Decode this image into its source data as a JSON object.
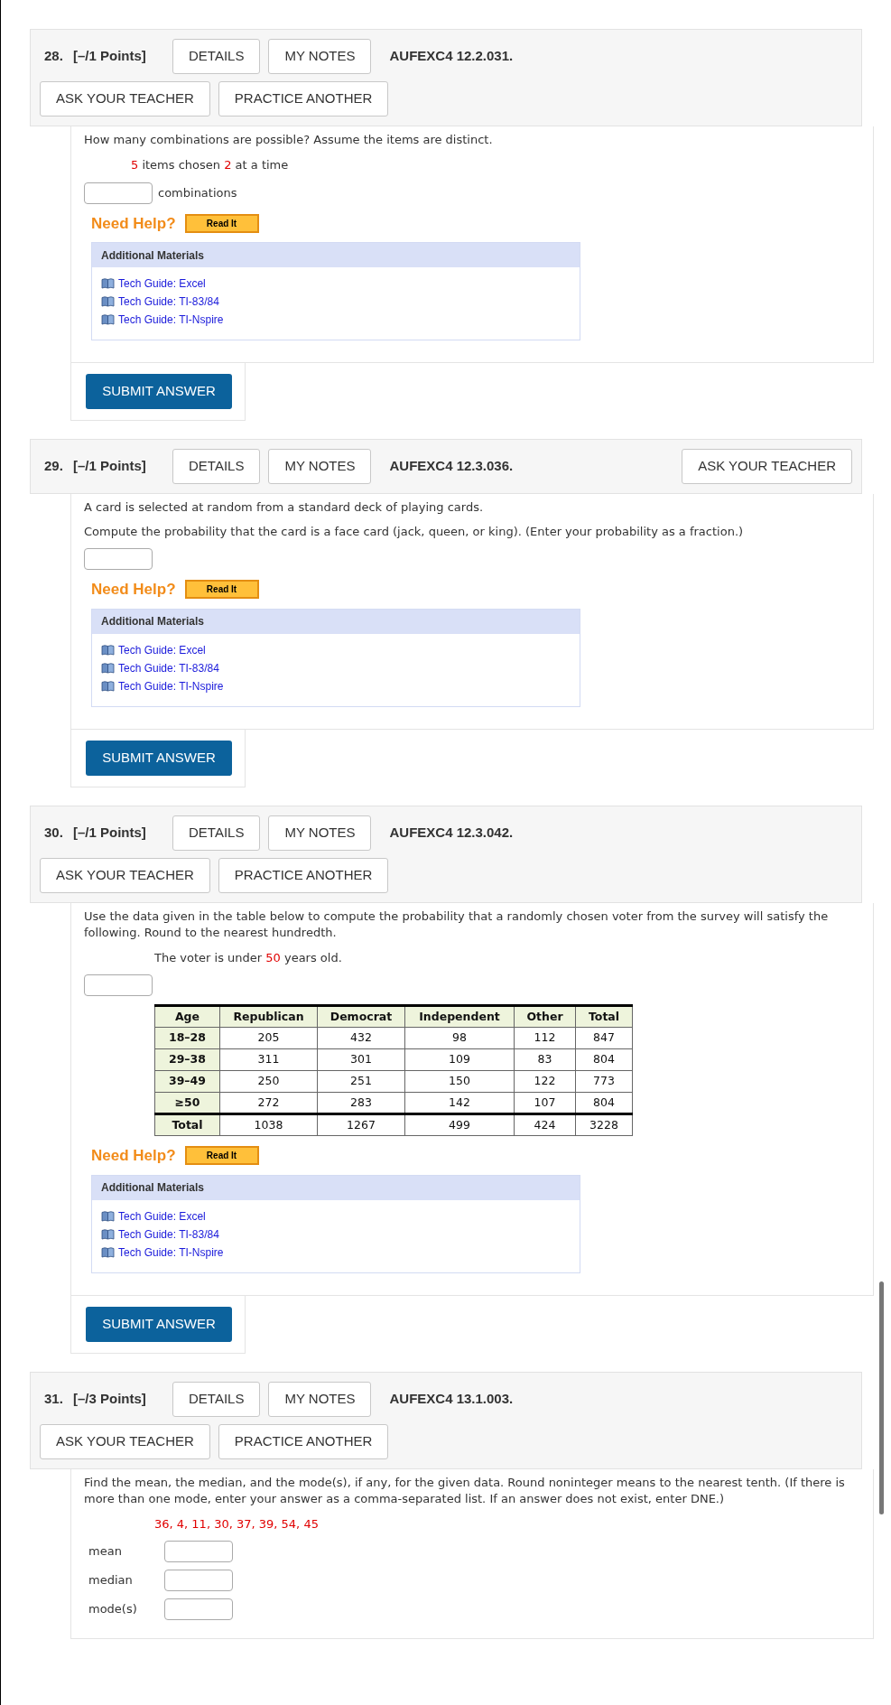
{
  "questions": [
    {
      "number": "28.",
      "points": "[–/1 Points]",
      "buttons": [
        "DETAILS",
        "MY NOTES"
      ],
      "code": "AUFEXC4 12.2.031.",
      "row2_buttons": [
        "ASK YOUR TEACHER",
        "PRACTICE ANOTHER"
      ],
      "blocks": [
        {
          "kind": "text",
          "text": "How many combinations are possible? Assume the items are distinct."
        },
        {
          "kind": "given",
          "parts": [
            {
              "text": "5",
              "highlight": true
            },
            {
              "text": " items chosen ",
              "highlight": false
            },
            {
              "text": "2",
              "highlight": true
            },
            {
              "text": " at a time",
              "highlight": false
            }
          ]
        },
        {
          "kind": "input",
          "suffix": "combinations"
        }
      ],
      "help": {
        "label": "Need Help?",
        "buttons": [
          "Read It"
        ],
        "materials_title": "Additional Materials",
        "links": [
          "Tech Guide: Excel",
          "Tech Guide: TI-83/84",
          "Tech Guide: TI-Nspire"
        ]
      },
      "submit": "SUBMIT ANSWER"
    },
    {
      "number": "29.",
      "points": "[–/1 Points]",
      "buttons": [
        "DETAILS",
        "MY NOTES"
      ],
      "code": "AUFEXC4 12.3.036.",
      "right_buttons": [
        "ASK YOUR TEACHER"
      ],
      "blocks": [
        {
          "kind": "text",
          "text": "A card is selected at random from a standard deck of playing cards."
        },
        {
          "kind": "text",
          "text": "Compute the probability that the card is a face card (jack, queen, or king). (Enter your probability as a fraction.)"
        },
        {
          "kind": "input"
        }
      ],
      "help": {
        "label": "Need Help?",
        "buttons": [
          "Read It"
        ],
        "materials_title": "Additional Materials",
        "links": [
          "Tech Guide: Excel",
          "Tech Guide: TI-83/84",
          "Tech Guide: TI-Nspire"
        ]
      },
      "submit": "SUBMIT ANSWER"
    },
    {
      "number": "30.",
      "points": "[–/1 Points]",
      "buttons": [
        "DETAILS",
        "MY NOTES"
      ],
      "code": "AUFEXC4 12.3.042.",
      "row2_buttons": [
        "ASK YOUR TEACHER",
        "PRACTICE ANOTHER"
      ],
      "blocks": [
        {
          "kind": "text",
          "text": "Use the data given in the table below to compute the probability that a randomly chosen voter from the survey will satisfy the following. Round to the nearest hundredth."
        },
        {
          "kind": "given",
          "parts": [
            {
              "text": "The voter is under ",
              "highlight": false
            },
            {
              "text": "50",
              "highlight": true
            },
            {
              "text": " years old.",
              "highlight": false
            }
          ]
        },
        {
          "kind": "input"
        },
        {
          "kind": "table",
          "columns": [
            "Age",
            "Republican",
            "Democrat",
            "Independent",
            "Other",
            "Total"
          ],
          "rows": [
            [
              "18–28",
              "205",
              "432",
              "98",
              "112",
              "847"
            ],
            [
              "29–38",
              "311",
              "301",
              "109",
              "83",
              "804"
            ],
            [
              "39–49",
              "250",
              "251",
              "150",
              "122",
              "773"
            ],
            [
              "≥50",
              "272",
              "283",
              "142",
              "107",
              "804"
            ],
            [
              "Total",
              "1038",
              "1267",
              "499",
              "424",
              "3228"
            ]
          ]
        }
      ],
      "help": {
        "label": "Need Help?",
        "buttons": [
          "Read It"
        ],
        "materials_title": "Additional Materials",
        "links": [
          "Tech Guide: Excel",
          "Tech Guide: TI-83/84",
          "Tech Guide: TI-Nspire"
        ]
      },
      "submit": "SUBMIT ANSWER"
    },
    {
      "number": "31.",
      "points": "[–/3 Points]",
      "buttons": [
        "DETAILS",
        "MY NOTES"
      ],
      "code": "AUFEXC4 13.1.003.",
      "row2_buttons": [
        "ASK YOUR TEACHER",
        "PRACTICE ANOTHER"
      ],
      "blocks": [
        {
          "kind": "text",
          "text": "Find the mean, the median, and the mode(s), if any, for the given data. Round noninteger means to the nearest tenth. (If there is more than one mode, enter your answer as a comma-separated list. If an answer does not exist, enter DNE.)"
        },
        {
          "kind": "given",
          "parts": [
            {
              "text": "36, 4, 11, 30, 37, 39, 54, 45",
              "highlight": true
            }
          ]
        },
        {
          "kind": "labeled_inputs",
          "labels": [
            "mean",
            "median",
            "mode(s)"
          ]
        }
      ]
    }
  ]
}
